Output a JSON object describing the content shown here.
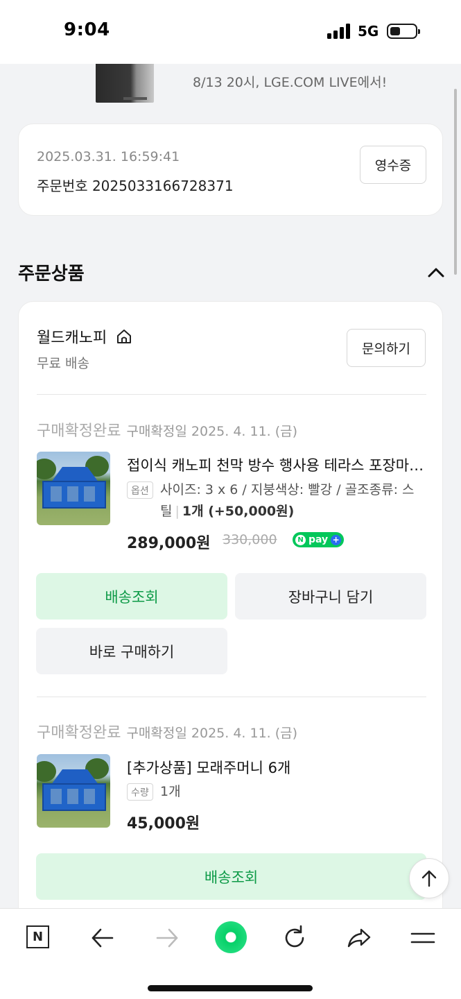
{
  "status_bar": {
    "time": "9:04",
    "network": "5G"
  },
  "banner": {
    "title_partial": "",
    "subtitle": "8/13 20시, LGE.COM LIVE에서!"
  },
  "order": {
    "datetime": "2025.03.31. 16:59:41",
    "order_number_label": "주문번호 2025033166728371",
    "receipt_button": "영수증"
  },
  "section": {
    "title": "주문상품"
  },
  "seller": {
    "name": "월드캐노피",
    "shipping": "무료 배송",
    "inquiry_button": "문의하기"
  },
  "items": [
    {
      "status": "구매확정완료",
      "confirm_date": "구매확정일 2025. 4. 11. (금)",
      "title": "접이식 캐노피 천막 방수 행사용 테라스 포장마차 캠핑 그늘막",
      "tag": "옵션",
      "option_line1": "사이즈: 3 x 6 / 지붕색상: 빨강 / 골조종류: 스",
      "option_line2_a": "틸",
      "option_qty": "1개 (+50,000원)",
      "price": "289,000원",
      "original_price": "330,000",
      "npay_label": "pay",
      "buttons": {
        "track": "배송조회",
        "cart": "장바구니 담기",
        "buy_now": "바로 구매하기"
      }
    },
    {
      "status": "구매확정완료",
      "confirm_date": "구매확정일 2025. 4. 11. (금)",
      "title": "[추가상품] 모래주머니 6개",
      "tag": "수량",
      "qty": "1개",
      "price": "45,000원",
      "buttons": {
        "track": "배송조회"
      }
    }
  ],
  "toolbar": {
    "icons": [
      "naver-n-icon",
      "back-arrow-icon",
      "forward-arrow-icon",
      "green-dot-icon",
      "refresh-icon",
      "share-icon",
      "menu-icon"
    ],
    "n_label": "N"
  },
  "colors": {
    "accent_green": "#03c75a",
    "track_bg": "#ddf7e5",
    "track_text": "#0d9a47"
  }
}
